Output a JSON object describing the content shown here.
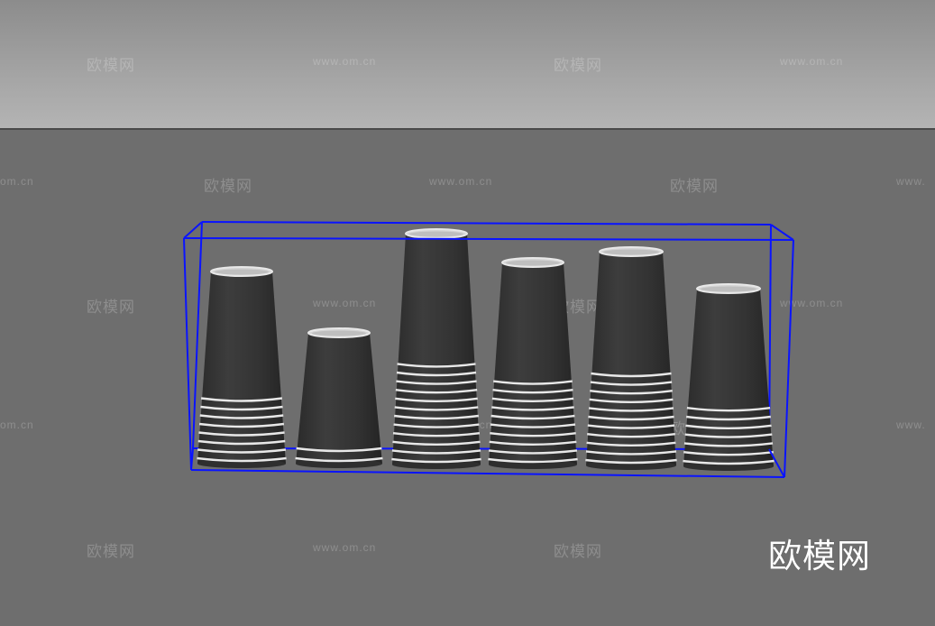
{
  "watermark": {
    "cn": "欧模网",
    "url": "www.om.cn",
    "url_partial_left": "om.cn",
    "url_partial_right": "www."
  },
  "brand_logo": "欧模网",
  "scene": {
    "object": "paper-cup-stacks",
    "cup_color": "#2f2f2f",
    "rim_color": "#e8e8e8",
    "bounding_box_color": "#0a14ff",
    "stacks": [
      {
        "name": "stack-1",
        "ring_count": 8
      },
      {
        "name": "stack-2",
        "ring_count": 2
      },
      {
        "name": "stack-3",
        "ring_count": 12
      },
      {
        "name": "stack-4",
        "ring_count": 10
      },
      {
        "name": "stack-5",
        "ring_count": 11
      },
      {
        "name": "stack-6",
        "ring_count": 7
      }
    ]
  }
}
